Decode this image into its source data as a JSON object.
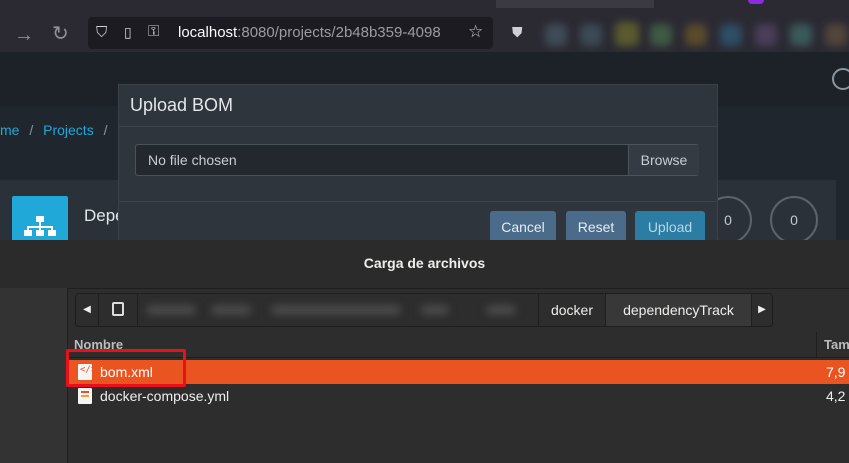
{
  "browser": {
    "url_host": "localhost",
    "url_rest": ":8080/projects/2b48b359-4098",
    "icons": [
      "back-arrow-icon",
      "forward-arrow-icon",
      "reload-icon",
      "shield-icon",
      "page-icon",
      "key-icon",
      "star-icon",
      "pocket-icon",
      "profile-icon"
    ]
  },
  "app": {
    "breadcrumb": {
      "home": "me",
      "sep1": "/",
      "projects": "Projects",
      "sep2": "/",
      "current": "I"
    },
    "card_title": "Depe",
    "gauges": [
      "0",
      "0"
    ],
    "colors": {
      "accent": "#20a8d8"
    }
  },
  "modal": {
    "title": "Upload BOM",
    "file_placeholder": "No file chosen",
    "browse_label": "Browse",
    "cancel_label": "Cancel",
    "reset_label": "Reset",
    "upload_label": "Upload"
  },
  "dialog": {
    "title": "Carga de archivos",
    "path": [
      "docker",
      "dependencyTrack"
    ],
    "columns": {
      "name": "Nombre",
      "size": "Tam"
    },
    "files": [
      {
        "name": "bom.xml",
        "size": "7,9",
        "icon": "xml-file-icon",
        "selected": true
      },
      {
        "name": "docker-compose.yml",
        "size": "4,2",
        "icon": "yml-file-icon",
        "selected": false
      }
    ],
    "colors": {
      "selection": "#e95420",
      "highlight_box": "#e8101a"
    }
  }
}
